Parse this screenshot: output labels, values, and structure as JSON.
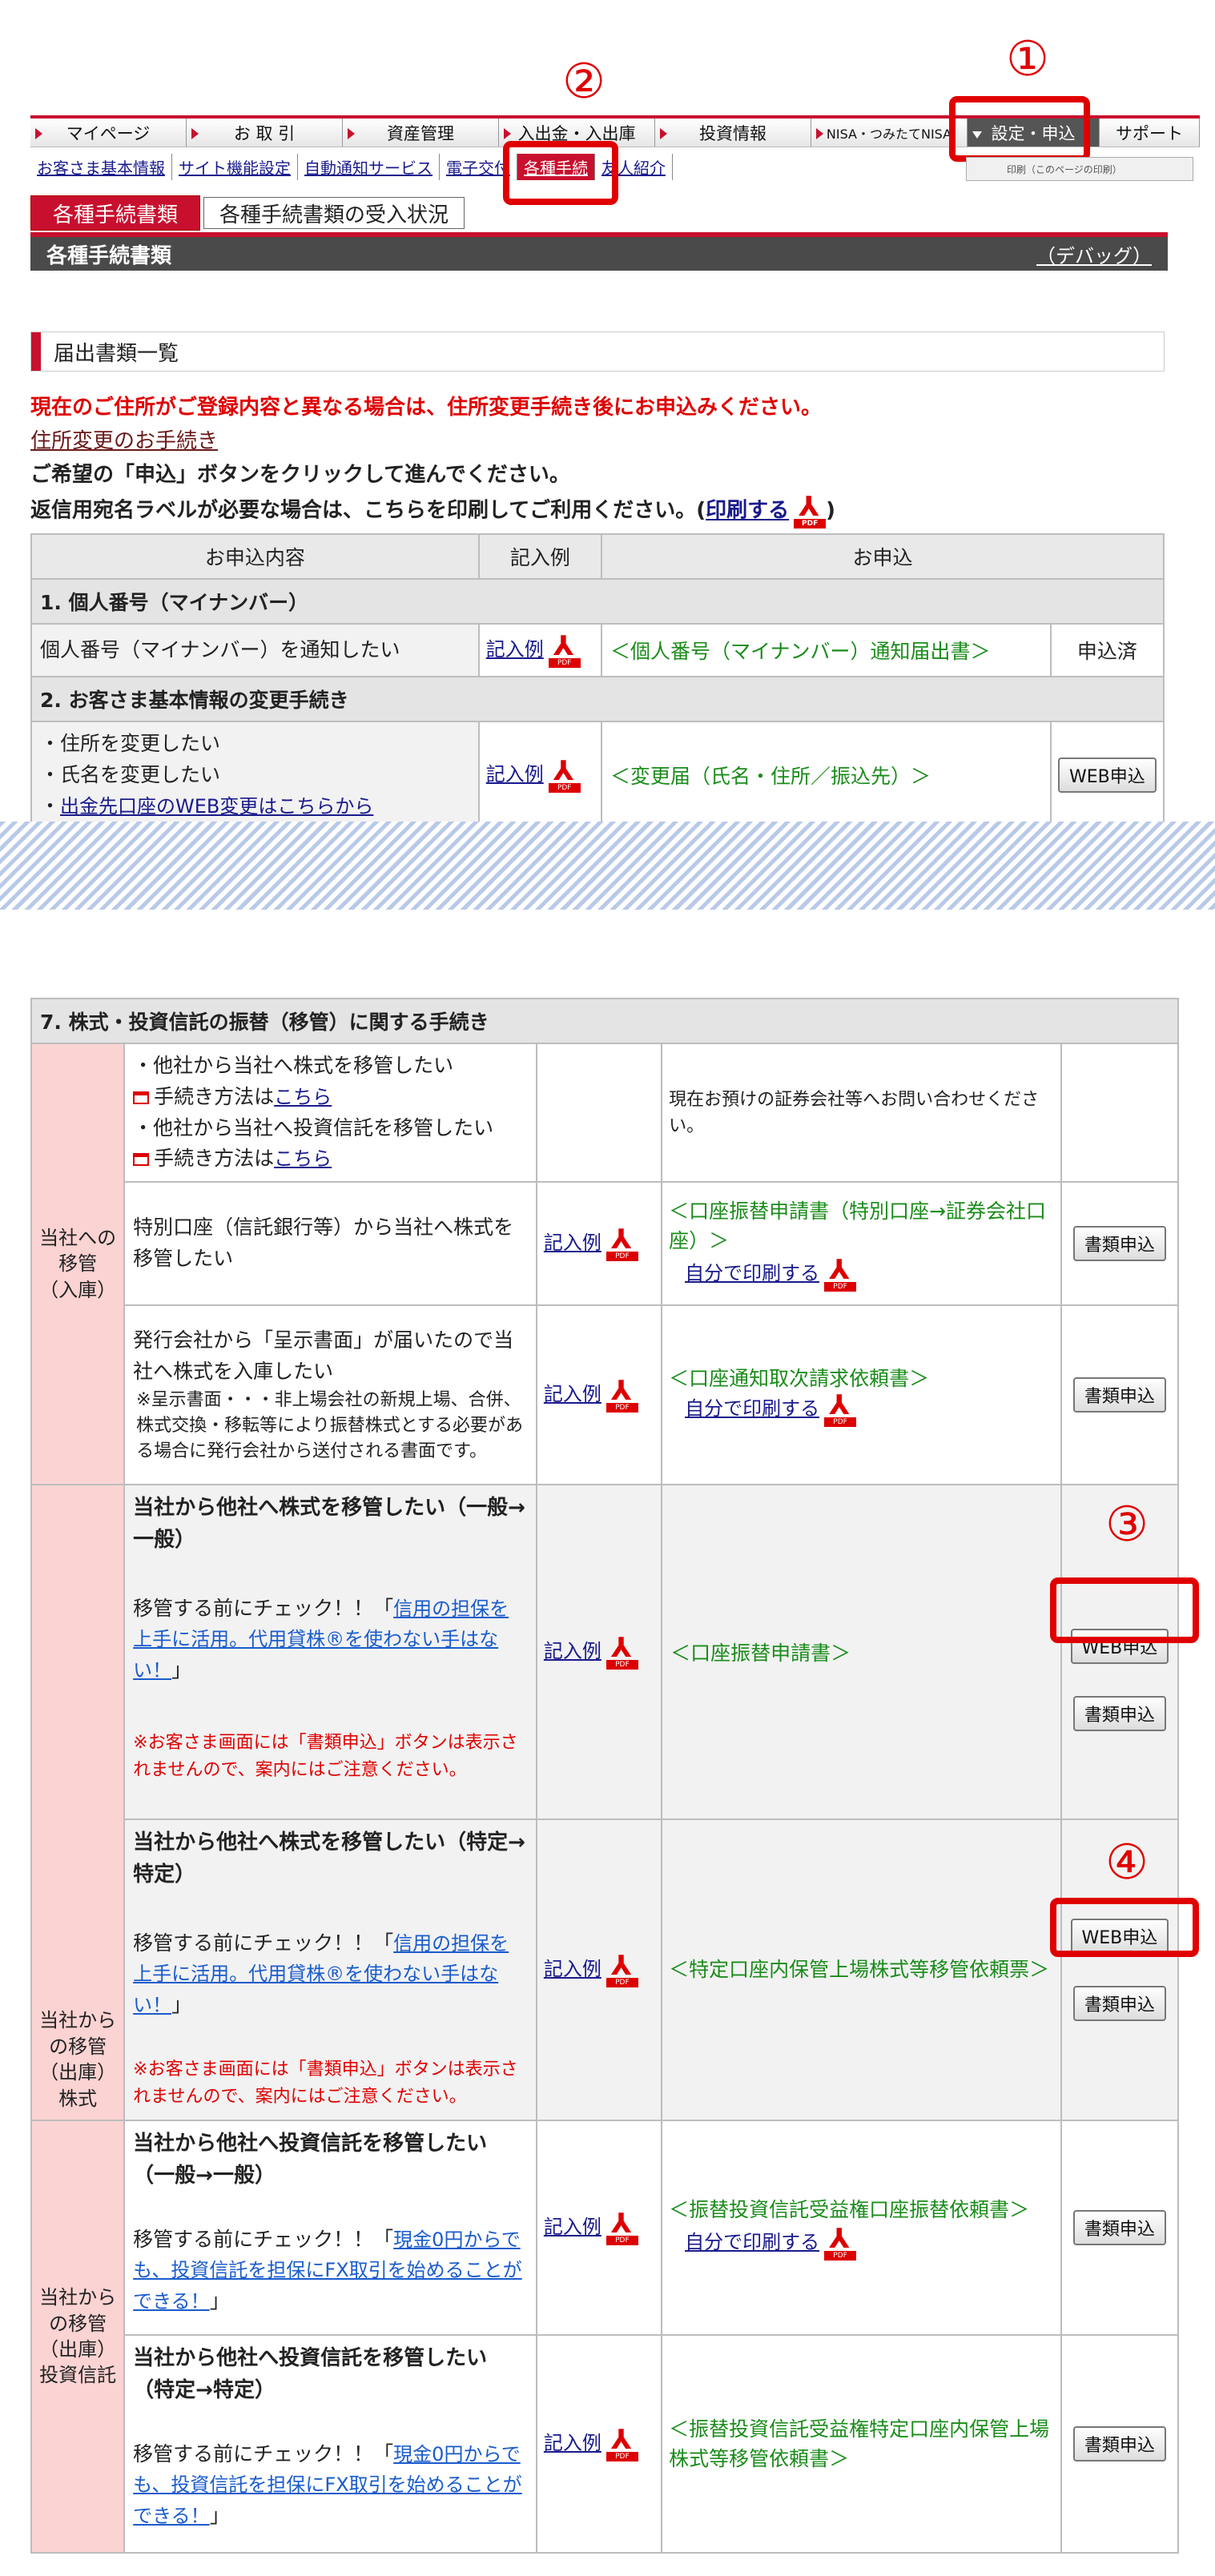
{
  "callouts": [
    "①",
    "②",
    "③",
    "④"
  ],
  "nav": {
    "items": [
      "マイページ",
      "お 取 引",
      "資産管理",
      "入出金・入出庫",
      "投資情報",
      "NISA・つみたてNISA",
      "設定・申込",
      "サポート"
    ],
    "sub": [
      "お客さま基本情報",
      "サイト機能設定",
      "自動通知サービス",
      "電子交付",
      "各種手続",
      "友人紹介"
    ],
    "print_label": "印刷（このページの印刷）"
  },
  "tabs": {
    "tab1": "各種手続書類",
    "tab2": "各種手続書類の受入状況"
  },
  "title": {
    "text": "各種手続書類",
    "debug": "（デバッグ）"
  },
  "section_header": "届出書類一覧",
  "notices": {
    "line1": "現在のご住所がご登録内容と異なる場合は、住所変更手続き後にお申込みください。",
    "link": "住所変更のお手続き",
    "line2": "ご希望の「申込」ボタンをクリックして進んでください。",
    "line3a": "返信用宛名ラベルが必要な場合は、こちらを印刷してご利用ください。(",
    "line3link": "印刷する",
    "line3b": ")"
  },
  "table1": {
    "headers": [
      "お申込内容",
      "記入例",
      "お申込"
    ],
    "sec1": "1. 個人番号（マイナンバー）",
    "row1": {
      "desc": "個人番号（マイナンバー）を通知したい",
      "example": "記入例",
      "form": "＜個人番号（マイナンバー）通知届出書＞",
      "status": "申込済"
    },
    "sec2": "2. お客さま基本情報の変更手続き",
    "row2": {
      "d1": "・住所を変更したい",
      "d2": "・氏名を変更したい",
      "d3a": "・",
      "d3link": "出金先口座のWEB変更はこちらから",
      "example": "記入例",
      "form": "＜変更届（氏名・住所／振込先）＞",
      "button": "WEB申込"
    }
  },
  "table2": {
    "sec7": "7. 株式・投資信託の振替（移管）に関する手続き",
    "cat_in": "当社への\n移管\n（入庫）",
    "cat_out_stock": "当社から\nの移管\n（出庫）\n株式",
    "cat_out_fund": "当社から\nの移管\n（出庫）\n投資信託",
    "r1": {
      "l1": "・他社から当社へ株式を移管したい",
      "l2a": "手続き方法は",
      "l2link": "こちら",
      "l3": "・他社から当社へ投資信託を移管したい",
      "l4a": "手続き方法は",
      "l4link": "こちら",
      "form": "現在お預けの証券会社等へお問い合わせください。"
    },
    "r2": {
      "desc": "特別口座（信託銀行等）から当社へ株式を移管したい",
      "example": "記入例",
      "form": "＜口座振替申請書（特別口座→証券会社口座）＞",
      "print": "自分で印刷する",
      "button": "書類申込"
    },
    "r3": {
      "desc": "発行会社から「呈示書面」が届いたので当社へ株式を入庫したい",
      "note": "※呈示書面・・・非上場会社の新規上場、合併、株式交換・移転等により振替株式とする必要がある場合に発行会社から送付される書面です。",
      "example": "記入例",
      "form": "＜口座通知取次請求依頼書＞",
      "print": "自分で印刷する",
      "button": "書類申込"
    },
    "r4": {
      "title": "当社から他社へ株式を移管したい（一般→一般）",
      "check": "移管する前にチェック！！「",
      "link": "信用の担保を上手に活用。代用貸株®を使わない手はない！",
      "close": "」",
      "note": "※お客さま画面には「書類申込」ボタンは表示されませんので、案内にはご注意ください。",
      "example": "記入例",
      "form": "＜口座振替申請書＞",
      "web": "WEB申込",
      "button": "書類申込"
    },
    "r5": {
      "title": "当社から他社へ株式を移管したい（特定→特定）",
      "check": "移管する前にチェック！！「",
      "link": "信用の担保を上手に活用。代用貸株®を使わない手はない！",
      "close": "」",
      "note": "※お客さま画面には「書類申込」ボタンは表示されませんので、案内にはご注意ください。",
      "example": "記入例",
      "form": "＜特定口座内保管上場株式等移管依頼票＞",
      "web": "WEB申込",
      "button": "書類申込"
    },
    "r6": {
      "title": "当社から他社へ投資信託を移管したい（一般→一般）",
      "check": "移管する前にチェック！！「",
      "link": "現金0円からでも、投資信託を担保にFX取引を始めることができる！",
      "close": "」",
      "example": "記入例",
      "form": "＜振替投資信託受益権口座振替依頼書＞",
      "print": "自分で印刷する",
      "button": "書類申込"
    },
    "r7": {
      "title": "当社から他社へ投資信託を移管したい（特定→特定）",
      "check": "移管する前にチェック！！「",
      "link": "現金0円からでも、投資信託を担保にFX取引を始めることができる！",
      "close": "」",
      "example": "記入例",
      "form": "＜振替投資信託受益権特定口座内保管上場株式等移管依頼書＞",
      "button": "書類申込"
    }
  }
}
